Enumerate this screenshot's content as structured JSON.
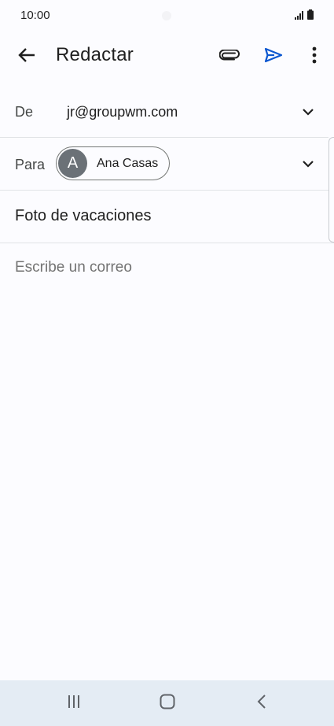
{
  "status_bar": {
    "time": "10:00"
  },
  "app_bar": {
    "title": "Redactar",
    "back_icon": "arrow-back-icon",
    "attach_icon": "paperclip-icon",
    "send_icon": "send-icon",
    "more_icon": "more-vert-icon"
  },
  "compose": {
    "from_label": "De",
    "from_value": "jr@groupwm.com",
    "to_label": "Para",
    "to_chip": {
      "initial": "A",
      "name": "Ana Casas"
    },
    "subject": "Foto de vacaciones",
    "body_placeholder": "Escribe un correo"
  },
  "colors": {
    "send_accent": "#0b57d0",
    "background": "#fcfcff",
    "nav_bar": "#e4ecf4",
    "avatar": "#6b7177"
  }
}
